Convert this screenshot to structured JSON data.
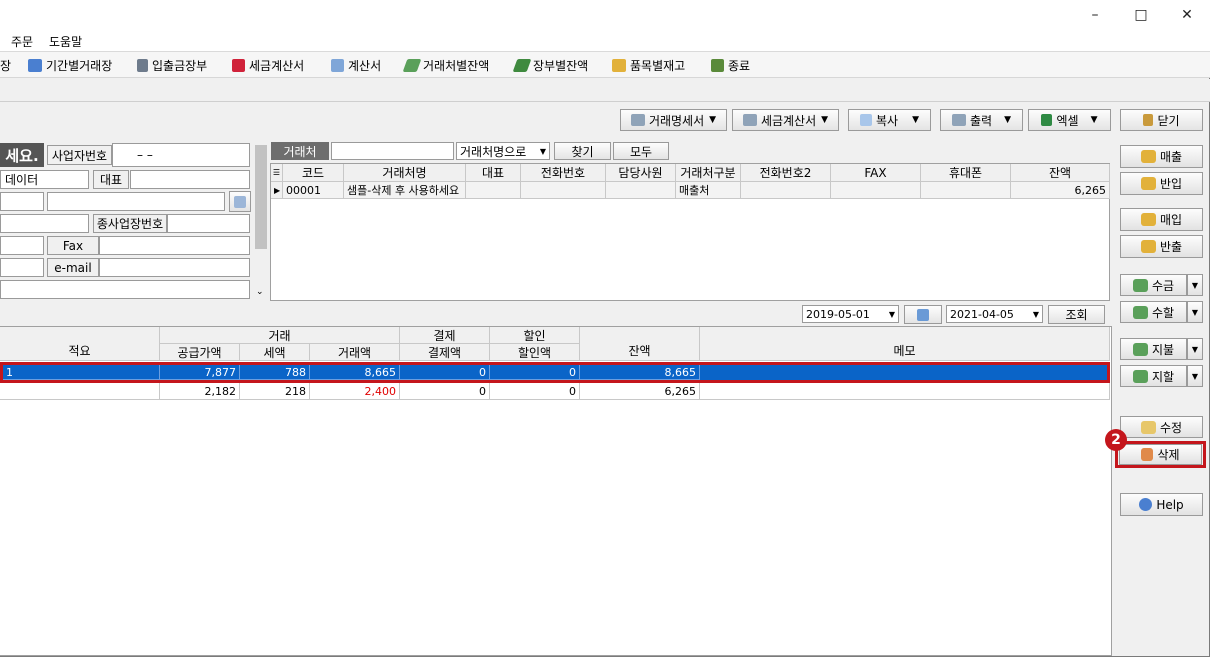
{
  "menu": {
    "order": "주문",
    "help": "도움말"
  },
  "toolbar": {
    "item0": "장",
    "item1": "기간별거래장",
    "item2": "입출금장부",
    "item3": "세금계산서",
    "item4": "계산서",
    "item5": "거래처별잔액",
    "item6": "장부별잔액",
    "item7": "품목별재고",
    "item8": "종료"
  },
  "actions": {
    "statement": "거래명세서",
    "tax_invoice": "세금계산서",
    "copy": "복사",
    "print": "출력",
    "excel": "엑셀",
    "close": "닫기"
  },
  "form": {
    "title_fragment": "세요.",
    "bizno_label": "사업자번호",
    "bizno_value": "–  –",
    "data_label": "데이터",
    "rep_label": "대표",
    "subbiz_label": "종사업장번호",
    "fax_label": "Fax",
    "email_label": "e-mail"
  },
  "search": {
    "tab_label": "거래처",
    "mode_select": "거래처명으로",
    "find": "찾기",
    "all": "모두"
  },
  "client_grid": {
    "headers": [
      "코드",
      "거래처명",
      "대표",
      "전화번호",
      "담당사원",
      "거래처구분",
      "전화번호2",
      "FAX",
      "휴대폰",
      "잔액"
    ],
    "row": {
      "code": "00001",
      "name": "샘플-삭제 후 사용하세요",
      "type": "매출처",
      "balance": "6,265"
    }
  },
  "date_filter": {
    "from": "2019-05-01",
    "to": "2021-04-05",
    "query": "조회"
  },
  "ledger": {
    "group_trade": "거래",
    "group_pay": "결제",
    "group_disc": "할인",
    "headers": [
      "적요",
      "공급가액",
      "세액",
      "거래액",
      "결제액",
      "할인액",
      "잔액",
      "메모"
    ],
    "rows": [
      {
        "memo_label": "1",
        "supply": "7,877",
        "tax": "788",
        "amount": "8,665",
        "paid": "0",
        "disc": "0",
        "balance": "8,665"
      },
      {
        "memo_label": "",
        "supply": "2,182",
        "tax": "218",
        "amount": "2,400",
        "paid": "0",
        "disc": "0",
        "balance": "6,265"
      }
    ]
  },
  "side": {
    "sale": "매출",
    "sale_return": "반입",
    "purchase": "매입",
    "purchase_return": "반출",
    "receive": "수금",
    "receive_disc": "수할",
    "pay": "지불",
    "pay_disc": "지할",
    "edit": "수정",
    "delete": "삭제",
    "help": "Help"
  },
  "step_badge": "2",
  "colors": {
    "selected_row": "#0a64c8",
    "highlight": "#c4161c",
    "negative": "#e00000"
  }
}
